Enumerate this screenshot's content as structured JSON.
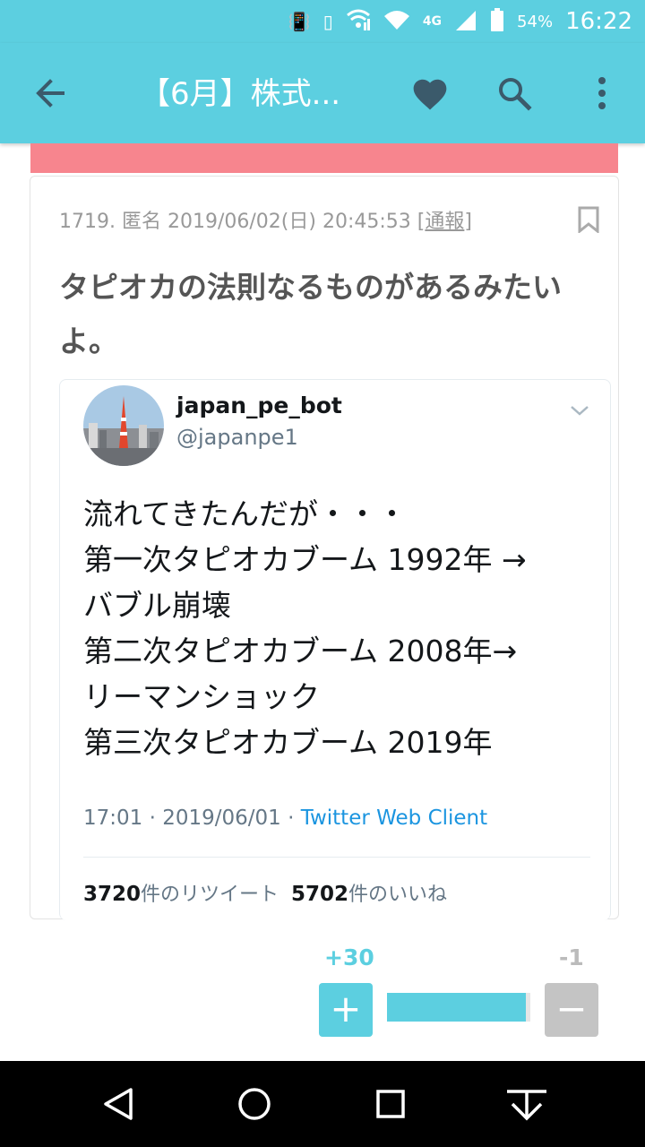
{
  "status_bar": {
    "battery": "54%",
    "time": "16:22",
    "network": "4G",
    "icons": [
      "vibrate-icon",
      "rotation-icon",
      "wifi-call-icon",
      "wifi-icon",
      "signal-icon",
      "battery-icon"
    ]
  },
  "app_bar": {
    "title": "【6月】株式...",
    "icons": [
      "back-arrow-icon",
      "heart-icon",
      "search-icon",
      "more-vert-icon"
    ]
  },
  "post": {
    "number": "1719.",
    "author": "匿名",
    "datetime": "2019/06/02(日) 20:45:53",
    "report_open": "[",
    "report_label": "通報",
    "report_close": "]",
    "body": "タピオカの法則なるものがあるみたいよ。"
  },
  "tweet": {
    "name": "japan_pe_bot",
    "handle": "@japanpe1",
    "lines": [
      "流れてきたんだが・・・",
      "第一次タピオカブーム 1992年 →",
      "バブル崩壊",
      "第二次タピオカブーム 2008年→",
      "リーマンショック",
      "第三次タピオカブーム 2019年"
    ],
    "timestamp": "17:01 · 2019/06/01 · ",
    "client": "Twitter Web Client",
    "retweets_count": "3720",
    "retweets_label": "件のリツイート",
    "likes_count": "5702",
    "likes_label": "件のいいね"
  },
  "votes": {
    "plus": "+30",
    "minus": "-1",
    "plus_symbol": "+",
    "minus_symbol": "−",
    "ratio": 0.968
  },
  "colors": {
    "accent": "#5ccfe0",
    "pink": "#f7858e",
    "twitter_link": "#1b95e0"
  }
}
